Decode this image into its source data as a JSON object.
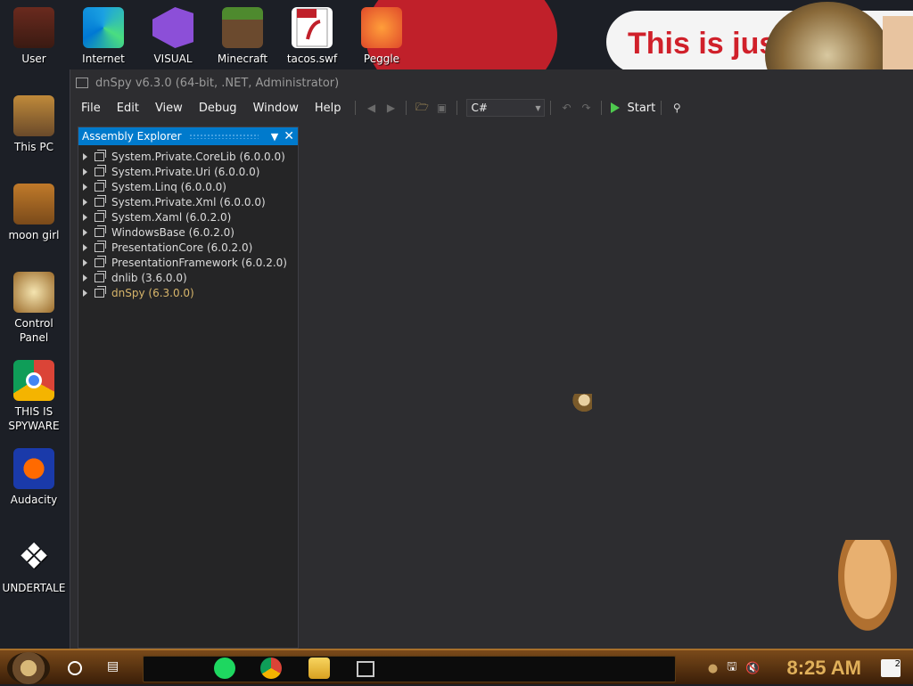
{
  "wallpaper": {
    "banner_text": "This is jus"
  },
  "desktop": {
    "icons": [
      {
        "label": "User",
        "icon": "user-icon"
      },
      {
        "label": "Internet",
        "icon": "edge-icon"
      },
      {
        "label": "VISUAL",
        "icon": "visual-studio-icon"
      },
      {
        "label": "Minecraft",
        "icon": "minecraft-icon"
      },
      {
        "label": "tacos.swf",
        "icon": "swf-file-icon"
      },
      {
        "label": "Peggle",
        "icon": "peggle-icon"
      },
      {
        "label": "This PC",
        "icon": "this-pc-icon"
      },
      {
        "label": "moon girl",
        "icon": "moon-girl-icon"
      },
      {
        "label": "Control Panel",
        "icon": "control-panel-icon"
      },
      {
        "label": "THIS IS SPYWARE",
        "icon": "chrome-icon"
      },
      {
        "label": "Audacity",
        "icon": "audacity-icon"
      },
      {
        "label": "UNDERTALE",
        "icon": "unity-icon"
      }
    ]
  },
  "window": {
    "title": "dnSpy v6.3.0 (64-bit, .NET, Administrator)",
    "menu": [
      "File",
      "Edit",
      "View",
      "Debug",
      "Window",
      "Help"
    ],
    "toolbar": {
      "language": "C#",
      "start_label": "Start"
    },
    "assembly_explorer": {
      "title": "Assembly Explorer",
      "items": [
        {
          "name": "System.Private.CoreLib",
          "version": "(6.0.0.0)"
        },
        {
          "name": "System.Private.Uri",
          "version": "(6.0.0.0)"
        },
        {
          "name": "System.Linq",
          "version": "(6.0.0.0)"
        },
        {
          "name": "System.Private.Xml",
          "version": "(6.0.0.0)"
        },
        {
          "name": "System.Xaml",
          "version": "(6.0.2.0)"
        },
        {
          "name": "WindowsBase",
          "version": "(6.0.2.0)"
        },
        {
          "name": "PresentationCore",
          "version": "(6.0.2.0)"
        },
        {
          "name": "PresentationFramework",
          "version": "(6.0.2.0)"
        },
        {
          "name": "dnlib",
          "version": "(3.6.0.0)"
        },
        {
          "name": "dnSpy",
          "version": "(6.3.0.0)"
        }
      ]
    }
  },
  "taskbar": {
    "clock": "8:25 AM",
    "notification_count": "2"
  },
  "colors": {
    "accent": "#007acc",
    "highlight": "#d7b56a",
    "window_bg": "#2d2d30",
    "clock": "#e0b05a"
  }
}
